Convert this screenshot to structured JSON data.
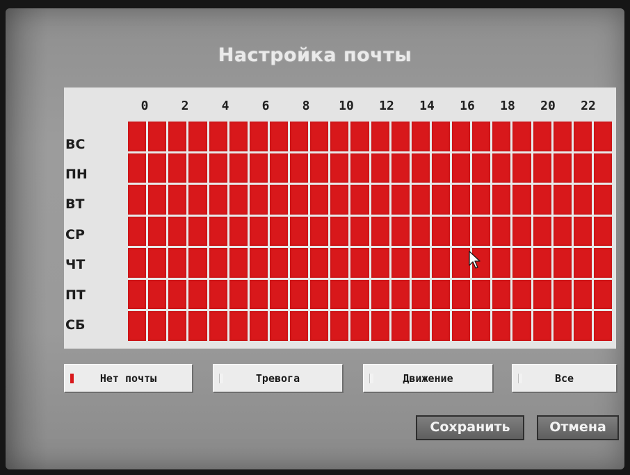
{
  "title": "Настройка почты",
  "hours": [
    "0",
    "2",
    "4",
    "6",
    "8",
    "10",
    "12",
    "14",
    "16",
    "18",
    "20",
    "22"
  ],
  "days": [
    "ВС",
    "ПН",
    "ВТ",
    "СР",
    "ЧТ",
    "ПТ",
    "СБ"
  ],
  "slots_per_day": 24,
  "cell_color": "#d8181b",
  "legend": [
    {
      "label": "Нет почты",
      "active": true
    },
    {
      "label": "Тревога",
      "active": false
    },
    {
      "label": "Движение",
      "active": false
    },
    {
      "label": "Все",
      "active": false
    }
  ],
  "buttons": {
    "save_label": "Сохранить",
    "cancel_label": "Отмена"
  },
  "icons": {
    "pointer": "mouse-pointer-icon"
  }
}
